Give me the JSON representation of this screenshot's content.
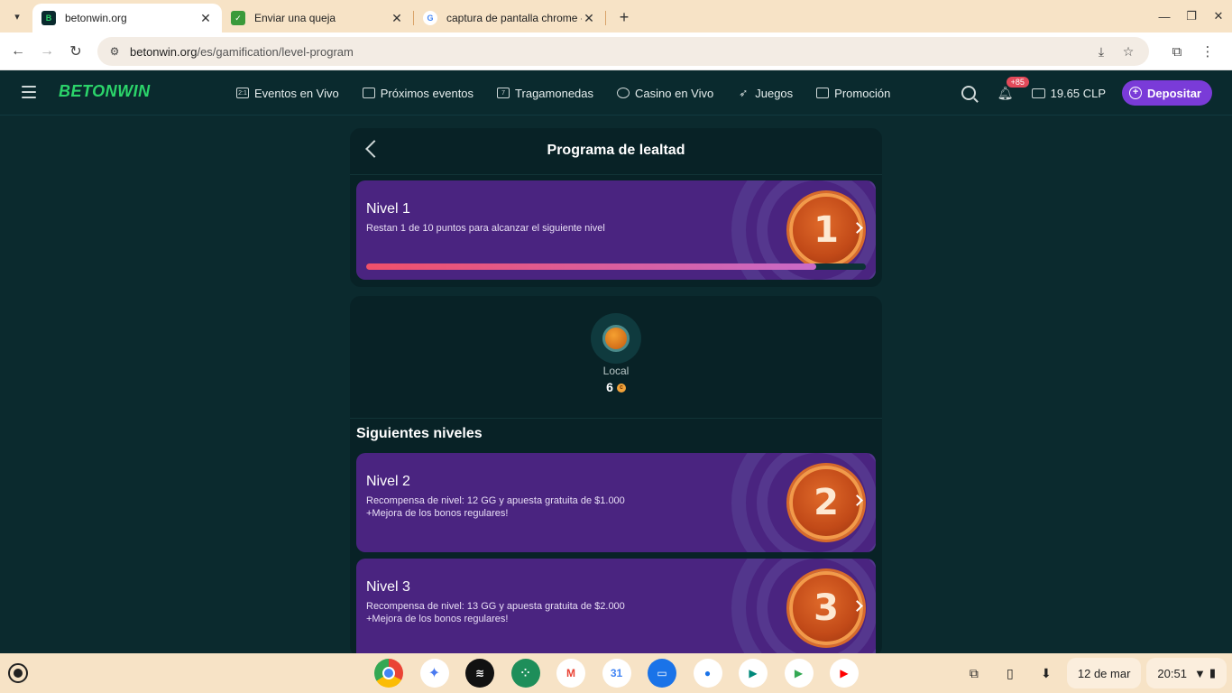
{
  "browser": {
    "tabs": [
      {
        "title": "betonwin.org",
        "active": true
      },
      {
        "title": "Enviar una queja",
        "active": false
      },
      {
        "title": "captura de pantalla chrome - B",
        "active": false
      }
    ],
    "url_host": "betonwin.org",
    "url_path": "/es/gamification/level-program"
  },
  "header": {
    "logo": "BETONWIN",
    "nav": [
      "Eventos en Vivo",
      "Próximos eventos",
      "Tragamonedas",
      "Casino en Vivo",
      "Juegos",
      "Promoción"
    ],
    "notifications_badge": "+85",
    "balance": "19.65 CLP",
    "deposit_label": "Depositar"
  },
  "loyalty": {
    "title": "Programa de lealtad",
    "current_level": {
      "title": "Nivel 1",
      "description": "Restan 1 de 10 puntos para alcanzar el siguiente nivel",
      "medal": "1",
      "progress_fraction": 0.9
    },
    "local": {
      "label": "Local",
      "points": "6",
      "coin_glyph": "c"
    },
    "next_levels_title": "Siguientes niveles",
    "next_levels": [
      {
        "title": "Nivel 2",
        "line1": "Recompensa de nivel: 12 GG y apuesta gratuita de $1.000",
        "line2": "+Mejora de los bonos regulares!",
        "medal": "2"
      },
      {
        "title": "Nivel 3",
        "line1": "Recompensa de nivel: 13 GG y apuesta gratuita de $2.000",
        "line2": "+Mejora de los bonos regulares!",
        "medal": "3"
      }
    ]
  },
  "taskbar": {
    "date": "12 de mar",
    "time": "20:51"
  },
  "colors": {
    "page_bg": "#0a2a2e",
    "card_purple": "#4a2480",
    "accent_green": "#2bd46a",
    "deposit_purple": "#7a3bd8"
  }
}
